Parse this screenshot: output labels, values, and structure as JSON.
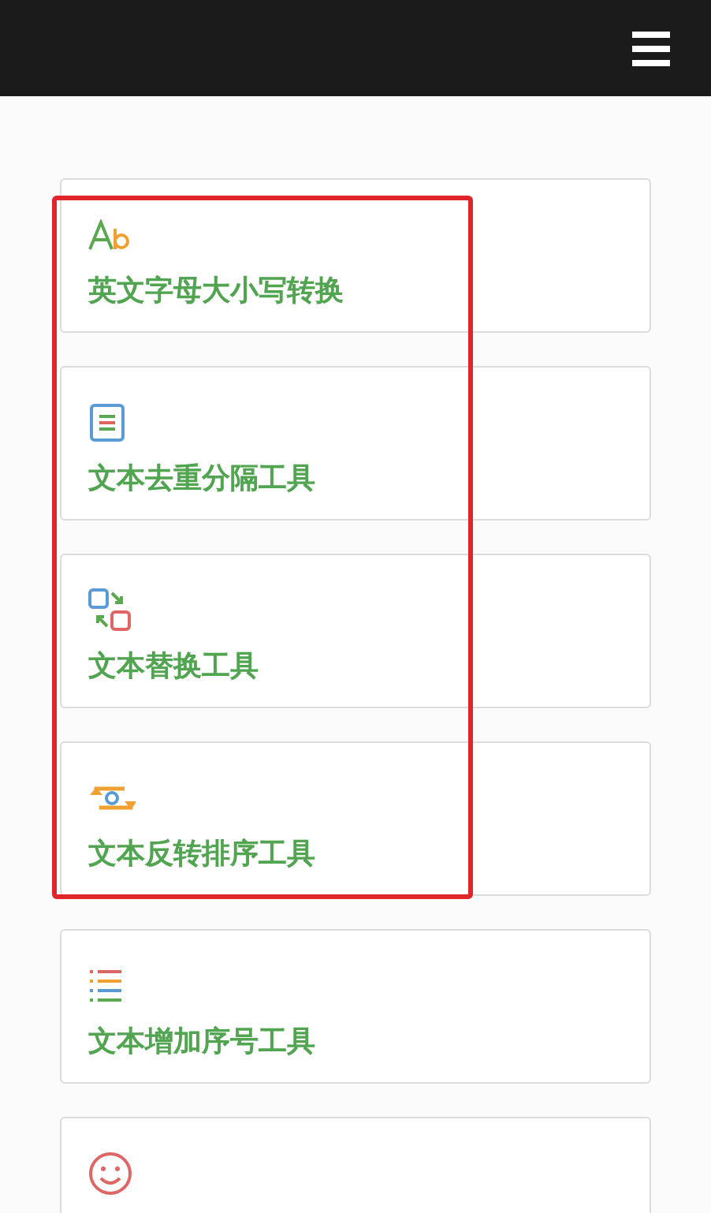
{
  "tools": [
    {
      "kind": "letters",
      "label": "英文字母大小写转换",
      "highlighted": true
    },
    {
      "kind": "document",
      "label": "文本去重分隔工具",
      "highlighted": true
    },
    {
      "kind": "swap",
      "label": "文本替换工具",
      "highlighted": true
    },
    {
      "kind": "cycle",
      "label": "文本反转排序工具",
      "highlighted": true
    },
    {
      "kind": "list",
      "label": "文本增加序号工具",
      "highlighted": false
    },
    {
      "kind": "smile",
      "highlighted": false
    }
  ]
}
